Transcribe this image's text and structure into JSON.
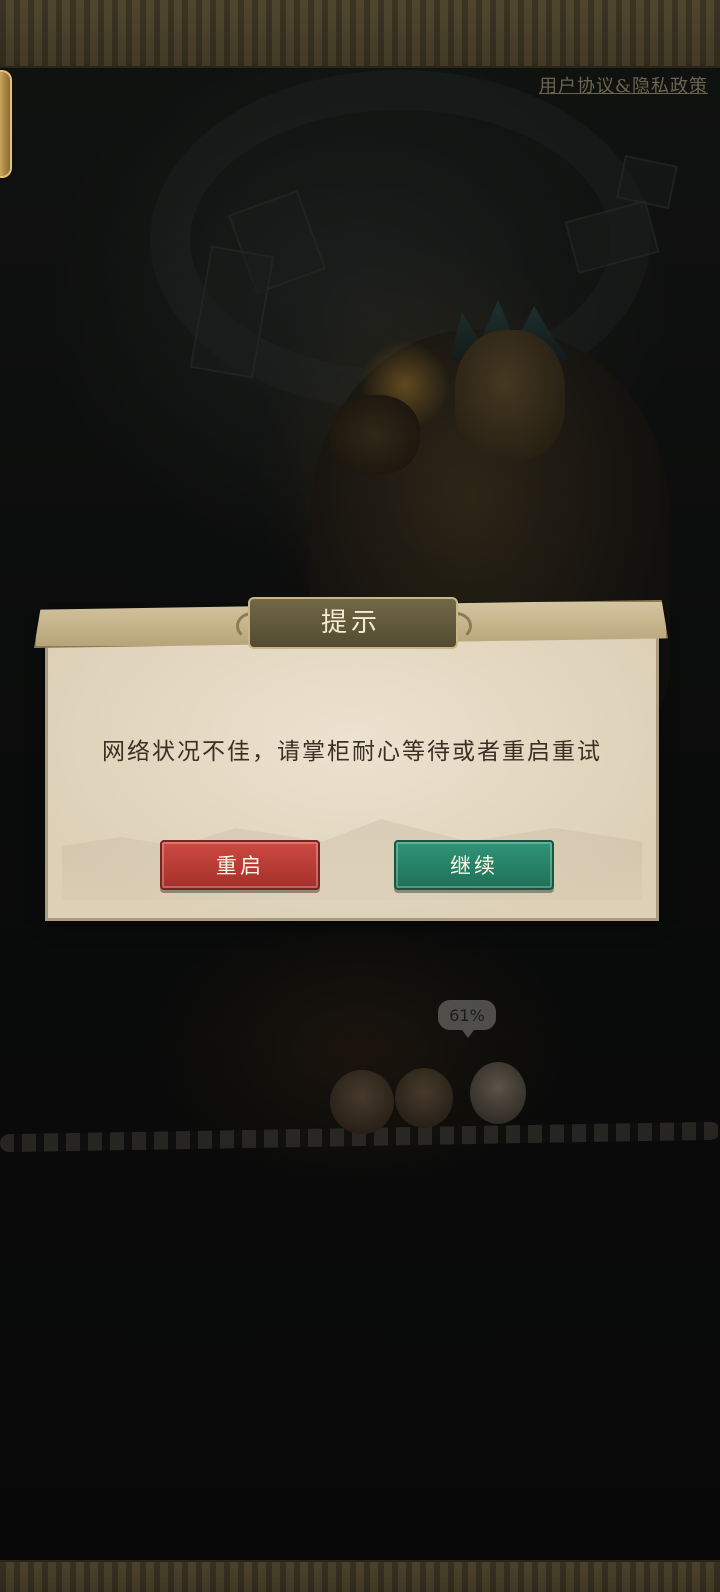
{
  "top_link": {
    "agreement": "用户协议&隐私政策"
  },
  "dialog": {
    "title": "提示",
    "message": "网络状况不佳，请掌柜耐心等待或者重启重试",
    "buttons": {
      "restart": "重启",
      "continue": "继续"
    }
  },
  "loading": {
    "progress_text": "61%",
    "progress_value": 0.61
  },
  "colors": {
    "restart_button": "#b83a33",
    "continue_button": "#268468",
    "dialog_bg": "#e6dac4",
    "title_plate": "#625a3c"
  }
}
